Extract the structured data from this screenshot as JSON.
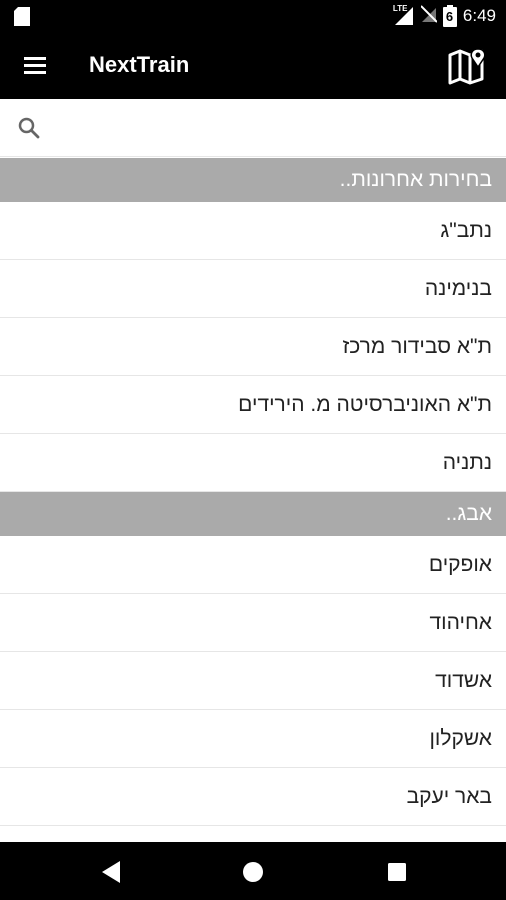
{
  "status_bar": {
    "network_label": "LTE",
    "battery_label": "6",
    "time": "6:49"
  },
  "app_bar": {
    "title": "NextTrain",
    "menu_icon": "hamburger-menu-icon",
    "map_icon": "map-icon"
  },
  "search": {
    "placeholder": "",
    "value": "",
    "icon": "search-icon"
  },
  "sections": [
    {
      "header": "בחירות אחרונות..",
      "items": [
        "נתב\"ג",
        "בנימינה",
        "ת\"א סבידור מרכז",
        "ת\"א האוניברסיטה מ. הירידים",
        "נתניה"
      ]
    },
    {
      "header": "אבג..",
      "items": [
        "אופקים",
        "אחיהוד",
        "אשדוד",
        "אשקלון",
        "באר יעקב"
      ]
    }
  ],
  "nav_bar": {
    "back_icon": "back-triangle-icon",
    "home_icon": "home-circle-icon",
    "recents_icon": "recents-square-icon"
  },
  "colors": {
    "app_bar_bg": "#000000",
    "section_header_bg": "#aaaaaa",
    "row_divider": "#e6e6e6"
  }
}
